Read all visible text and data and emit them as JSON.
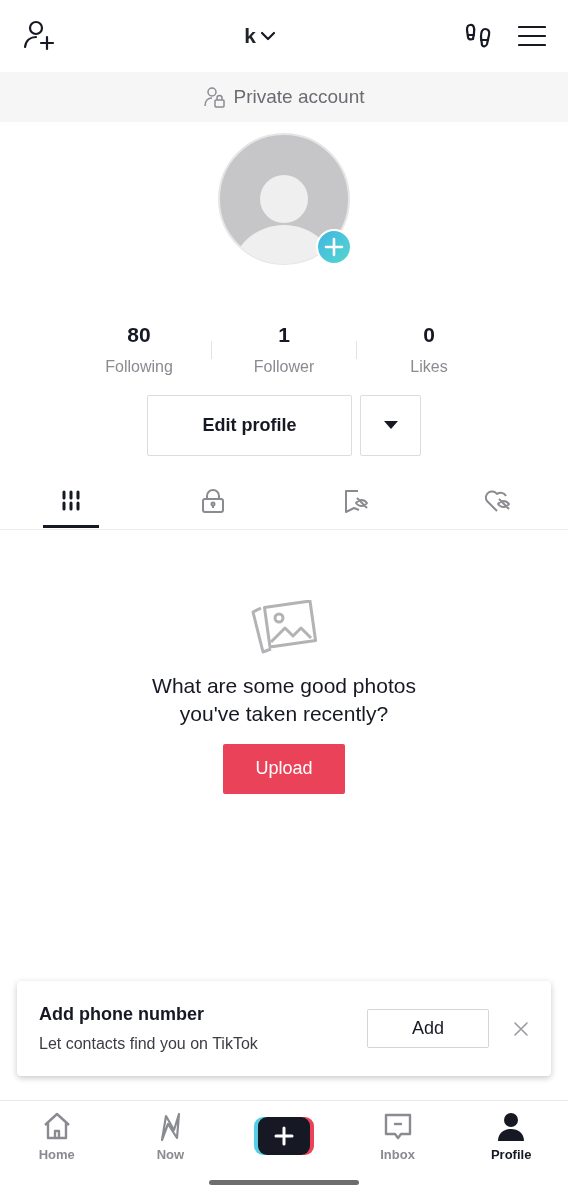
{
  "header": {
    "username": "k"
  },
  "privacy_banner": {
    "label": "Private account"
  },
  "stats": [
    {
      "value": "80",
      "label": "Following"
    },
    {
      "value": "1",
      "label": "Follower"
    },
    {
      "value": "0",
      "label": "Likes"
    }
  ],
  "edit_button": "Edit profile",
  "tabs": [
    {
      "kind": "grid",
      "selected": true
    },
    {
      "kind": "lock",
      "selected": false
    },
    {
      "kind": "saved",
      "selected": false
    },
    {
      "kind": "liked",
      "selected": false
    }
  ],
  "empty_state": {
    "message": "What are some good photos you've taken recently?",
    "button": "Upload"
  },
  "phone_prompt": {
    "title": "Add phone number",
    "subtitle": "Let contacts find you on TikTok",
    "button": "Add"
  },
  "nav": [
    {
      "kind": "home",
      "label": "Home",
      "selected": false
    },
    {
      "kind": "now",
      "label": "Now",
      "selected": false
    },
    {
      "kind": "create",
      "selected": false
    },
    {
      "kind": "inbox",
      "label": "Inbox",
      "selected": false
    },
    {
      "kind": "profile",
      "label": "Profile",
      "selected": true
    }
  ]
}
